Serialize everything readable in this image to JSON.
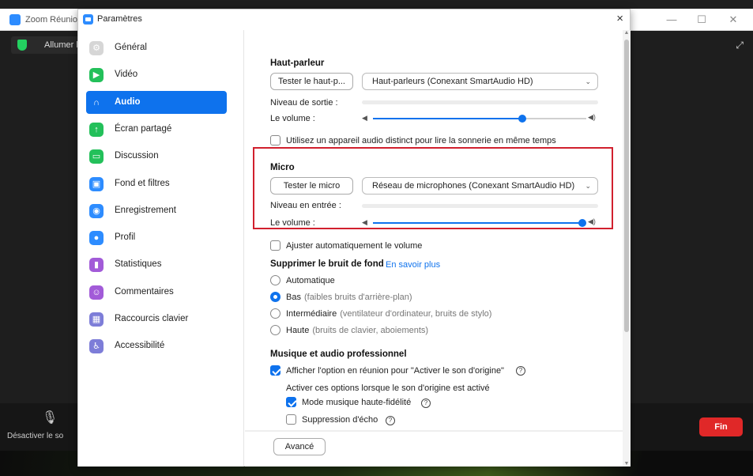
{
  "background": {
    "window_title": "Zoom Réunio",
    "banner_text": "Allumer l",
    "mic_label": "Désactiver le so",
    "end_button": "Fin"
  },
  "dialog": {
    "title": "Paramètres",
    "close": "×"
  },
  "sidebar": {
    "items": [
      {
        "label": "Général",
        "icon": "gear-icon",
        "color": "#d6d6d6",
        "glyph": "⚙"
      },
      {
        "label": "Vidéo",
        "icon": "video-icon",
        "color": "#23c05a",
        "glyph": "▶"
      },
      {
        "label": "Audio",
        "icon": "headphones-icon",
        "color": "#0e72ed",
        "glyph": "∩"
      },
      {
        "label": "Écran partagé",
        "icon": "share-screen-icon",
        "color": "#23c05a",
        "glyph": "↑"
      },
      {
        "label": "Discussion",
        "icon": "chat-icon",
        "color": "#23c05a",
        "glyph": "▭"
      },
      {
        "label": "Fond et filtres",
        "icon": "background-icon",
        "color": "#2d8cff",
        "glyph": "▣"
      },
      {
        "label": "Enregistrement",
        "icon": "record-icon",
        "color": "#2d8cff",
        "glyph": "◉"
      },
      {
        "label": "Profil",
        "icon": "profile-icon",
        "color": "#2d8cff",
        "glyph": "●"
      },
      {
        "label": "Statistiques",
        "icon": "statistics-icon",
        "color": "#a25bd8",
        "glyph": "▮"
      },
      {
        "label": "Commentaires",
        "icon": "feedback-icon",
        "color": "#a25bd8",
        "glyph": "☺"
      },
      {
        "label": "Raccourcis clavier",
        "icon": "keyboard-icon",
        "color": "#7d7dd8",
        "glyph": "▦"
      },
      {
        "label": "Accessibilité",
        "icon": "accessibility-icon",
        "color": "#7d7dd8",
        "glyph": "♿"
      }
    ],
    "active_index": 2
  },
  "speaker": {
    "title": "Haut-parleur",
    "test_button": "Tester le haut-p...",
    "device": "Haut-parleurs (Conexant SmartAudio HD)",
    "output_level_label": "Niveau de sortie :",
    "volume_label": "Le volume :",
    "volume": 0.7,
    "separate_device_label": "Utilisez un appareil audio distinct pour lire la sonnerie en même temps"
  },
  "micro": {
    "title": "Micro",
    "test_button": "Tester le micro",
    "device": "Réseau de microphones (Conexant SmartAudio HD)",
    "input_level_label": "Niveau en entrée :",
    "volume_label": "Le volume :",
    "volume": 0.98,
    "auto_adjust_label": "Ajuster automatiquement le volume"
  },
  "noise": {
    "title": "Supprimer le bruit de fond",
    "learn_more": "En savoir plus",
    "options": [
      {
        "label": "Automatique",
        "sub": "",
        "checked": false
      },
      {
        "label": "Bas",
        "sub": "(faibles bruits d'arrière-plan)",
        "checked": true
      },
      {
        "label": "Intermédiaire",
        "sub": "(ventilateur d'ordinateur, bruits de stylo)",
        "checked": false
      },
      {
        "label": "Haute",
        "sub": "(bruits de clavier, aboiements)",
        "checked": false
      }
    ]
  },
  "music": {
    "title": "Musique et audio professionnel",
    "show_option_label": "Afficher l'option en réunion pour \"Activer le son d'origine\"",
    "enable_when_label": "Activer ces options lorsque le son d'origine est activé",
    "hifi_label": "Mode musique haute-fidélité",
    "echo_label": "Suppression d'écho"
  },
  "advanced_button": "Avancé"
}
